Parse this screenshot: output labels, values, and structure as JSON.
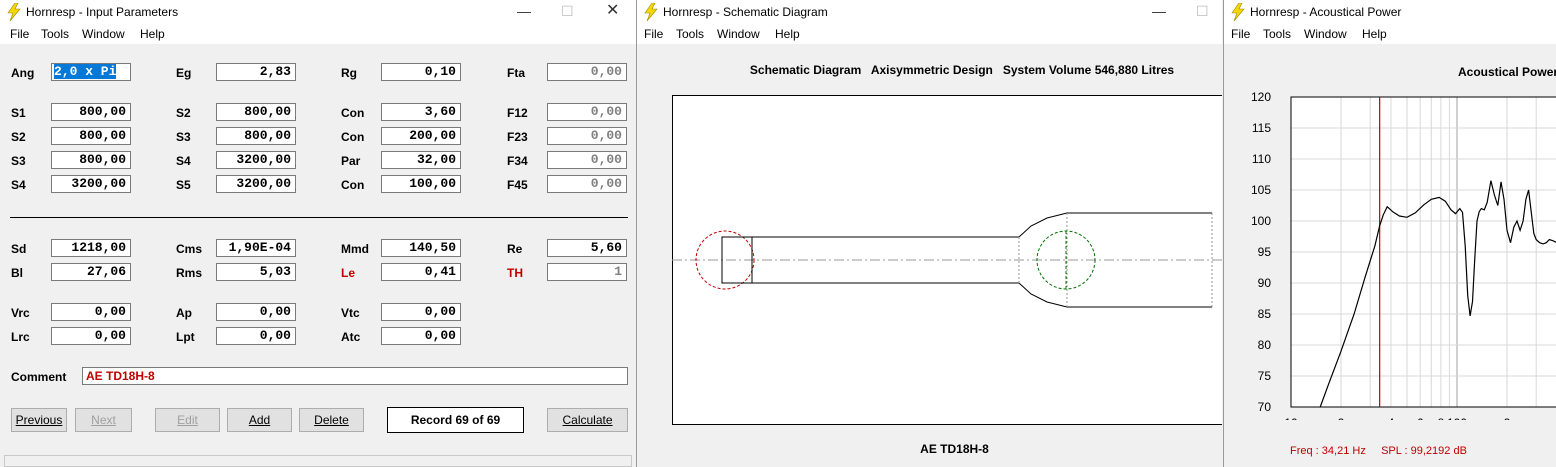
{
  "input_window": {
    "title": "Hornresp - Input Parameters",
    "menu": [
      "File",
      "Tools",
      "Window",
      "Help"
    ],
    "left_col": [
      {
        "label": "Ang",
        "value": "2,0 x Pi"
      },
      {
        "label": "S1",
        "value": "800,00"
      },
      {
        "label": "S2",
        "value": "800,00"
      },
      {
        "label": "S3",
        "value": "800,00"
      },
      {
        "label": "S4",
        "value": "3200,00"
      }
    ],
    "col2": [
      {
        "label": "Eg",
        "value": "2,83"
      },
      {
        "label": "S2",
        "value": "800,00"
      },
      {
        "label": "S3",
        "value": "800,00"
      },
      {
        "label": "S4",
        "value": "3200,00"
      },
      {
        "label": "S5",
        "value": "3200,00"
      }
    ],
    "col3": [
      {
        "label": "Rg",
        "value": "0,10"
      },
      {
        "label": "Con",
        "value": "3,60"
      },
      {
        "label": "Con",
        "value": "200,00"
      },
      {
        "label": "Par",
        "value": "32,00"
      },
      {
        "label": "Con",
        "value": "100,00"
      }
    ],
    "col4": [
      {
        "label": "Fta",
        "value": "0,00"
      },
      {
        "label": "F12",
        "value": "0,00"
      },
      {
        "label": "F23",
        "value": "0,00"
      },
      {
        "label": "F34",
        "value": "0,00"
      },
      {
        "label": "F45",
        "value": "0,00"
      }
    ],
    "driver": {
      "sd": {
        "label": "Sd",
        "value": "1218,00"
      },
      "bl": {
        "label": "Bl",
        "value": "27,06"
      },
      "cms": {
        "label": "Cms",
        "value": "1,90E-04"
      },
      "rms": {
        "label": "Rms",
        "value": "5,03"
      },
      "mmd": {
        "label": "Mmd",
        "value": "140,50"
      },
      "le": {
        "label": "Le",
        "value": "0,41"
      },
      "re": {
        "label": "Re",
        "value": "5,60"
      },
      "th": {
        "label": "TH",
        "value": "1"
      }
    },
    "chambers": {
      "vrc": {
        "label": "Vrc",
        "value": "0,00"
      },
      "lrc": {
        "label": "Lrc",
        "value": "0,00"
      },
      "ap": {
        "label": "Ap",
        "value": "0,00"
      },
      "lpt": {
        "label": "Lpt",
        "value": "0,00"
      },
      "vtc": {
        "label": "Vtc",
        "value": "0,00"
      },
      "atc": {
        "label": "Atc",
        "value": "0,00"
      }
    },
    "comment_label": "Comment",
    "comment_value": "AE TD18H-8",
    "buttons": {
      "previous": "Previous",
      "next": "Next",
      "edit": "Edit",
      "add": "Add",
      "delete": "Delete",
      "calculate": "Calculate"
    },
    "record": "Record 69 of 69"
  },
  "schematic_window": {
    "title": "Hornresp - Schematic Diagram",
    "menu": [
      "File",
      "Tools",
      "Window",
      "Help"
    ],
    "header": "Schematic Diagram   Axisymmetric Design   System Volume 546,880 Litres",
    "footer": "AE TD18H-8"
  },
  "acoustic_window": {
    "title": "Hornresp - Acoustical Power",
    "menu": [
      "File",
      "Tools",
      "Window",
      "Help"
    ],
    "chart_title": "Acoustical Power",
    "status": "Freq : 34,21 Hz     SPL : 99,2192 dB"
  },
  "colors": {
    "marker": "#c00000",
    "status_text": "#c00000",
    "curve": "#000000"
  },
  "chart_data": {
    "type": "line",
    "title": "Acoustical Power",
    "xscale": "log",
    "xlim": [
      10,
      450
    ],
    "ylim": [
      70,
      120
    ],
    "y_ticks": [
      "120",
      "115",
      "110",
      "105",
      "100",
      "95",
      "90",
      "85",
      "80",
      "75",
      "70"
    ],
    "x_ticks": [
      "10",
      "2",
      "4",
      "6",
      "8",
      "100",
      "2",
      "4"
    ],
    "marker_freq": 34.21,
    "series": [
      {
        "x": [
          15,
          17,
          20,
          24,
          28,
          32,
          34.2,
          36,
          38,
          41,
          45,
          50,
          56,
          63,
          70,
          78,
          85,
          92,
          98,
          104,
          108,
          112,
          116,
          120,
          124,
          128,
          132,
          136,
          140,
          146,
          152,
          160,
          168,
          176,
          184,
          192,
          200,
          210,
          220,
          230,
          240,
          250,
          260,
          270,
          280,
          290,
          300,
          315,
          330,
          345,
          360,
          380,
          400,
          420,
          450
        ],
        "y": [
          70,
          74,
          79,
          85,
          91,
          96,
          99.2,
          101,
          102.3,
          101.5,
          100.8,
          100.6,
          101.3,
          102.6,
          103.5,
          103.8,
          103.2,
          101.8,
          101.2,
          102,
          101.4,
          96,
          88,
          84.7,
          87,
          94,
          100,
          101.5,
          102,
          101.8,
          103,
          106.5,
          104.2,
          102.5,
          106.3,
          103.5,
          98.5,
          96.5,
          99,
          100,
          98.5,
          100,
          103.5,
          105,
          101.5,
          98,
          97,
          96.5,
          96.3,
          96.5,
          97,
          96.8,
          96.5,
          96.4,
          96.3
        ]
      }
    ]
  }
}
